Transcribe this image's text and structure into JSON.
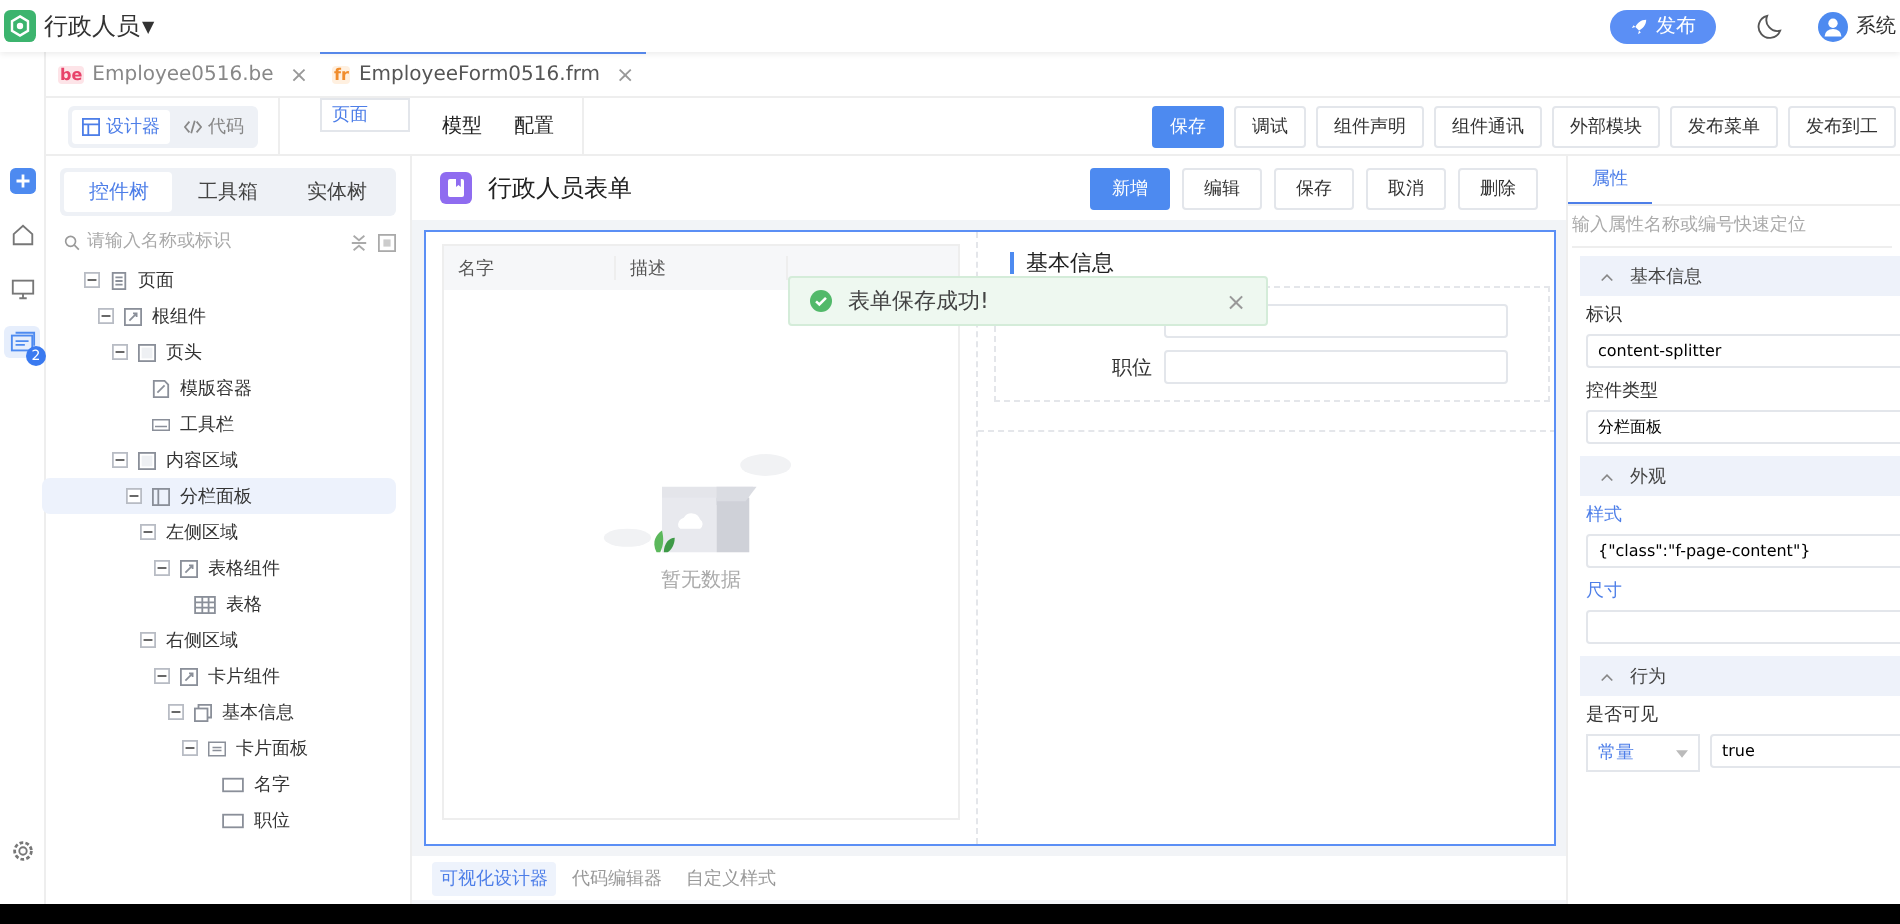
{
  "header": {
    "title": "行政人员",
    "caret": "▼",
    "publish": "发布",
    "user": "系统"
  },
  "file_tabs": [
    {
      "badge": "be",
      "kind": "be",
      "label": "Employee0516.be",
      "close": "×",
      "selected": false
    },
    {
      "badge": "fr",
      "kind": "fr",
      "label": "EmployeeForm0516.frm",
      "close": "×",
      "selected": true
    }
  ],
  "mode_switch": [
    {
      "label": "设计器",
      "kind": "designer",
      "selected": true
    },
    {
      "label": "代码",
      "kind": "code",
      "selected": false
    }
  ],
  "page_tabs": [
    {
      "label": "页面",
      "selected": true
    },
    {
      "label": "模型",
      "selected": false
    },
    {
      "label": "配置",
      "selected": false
    }
  ],
  "toolbar": [
    {
      "label": "保存",
      "primary": true
    },
    {
      "label": "调试",
      "primary": false
    },
    {
      "label": "组件声明",
      "primary": false
    },
    {
      "label": "组件通讯",
      "primary": false
    },
    {
      "label": "外部模块",
      "primary": false
    },
    {
      "label": "发布菜单",
      "primary": false
    },
    {
      "label": "发布到工",
      "primary": false
    }
  ],
  "rail": [
    {
      "kind": "add",
      "selected": false
    },
    {
      "kind": "home",
      "selected": false
    },
    {
      "kind": "monitor",
      "selected": false
    },
    {
      "kind": "cards",
      "selected": true,
      "badge": "2"
    }
  ],
  "left_panel": {
    "tabs": [
      {
        "label": "控件树",
        "selected": true
      },
      {
        "label": "工具箱",
        "selected": false
      },
      {
        "label": "实体树",
        "selected": false
      }
    ],
    "search": {
      "placeholder": "请输入名称或标识"
    },
    "tree": [
      {
        "label": "页面",
        "kind": "page",
        "expanded": true,
        "selected": false,
        "children": [
          {
            "label": "根组件",
            "kind": "component",
            "expanded": true,
            "selected": false,
            "children": [
              {
                "label": "页头",
                "kind": "frame",
                "expanded": true,
                "selected": false,
                "children": [
                  {
                    "label": "模版容器",
                    "kind": "template",
                    "selected": false
                  },
                  {
                    "label": "工具栏",
                    "kind": "toolbar",
                    "selected": false
                  }
                ]
              },
              {
                "label": "内容区域",
                "kind": "frame",
                "expanded": true,
                "selected": false,
                "children": [
                  {
                    "label": "分栏面板",
                    "kind": "splitter",
                    "expanded": true,
                    "selected": true,
                    "children": [
                      {
                        "label": "左侧区域",
                        "expanded": true,
                        "selected": false,
                        "children": [
                          {
                            "label": "表格组件",
                            "kind": "component",
                            "expanded": true,
                            "selected": false,
                            "children": [
                              {
                                "label": "表格",
                                "kind": "table",
                                "selected": false
                              }
                            ]
                          }
                        ]
                      },
                      {
                        "label": "右侧区域",
                        "expanded": true,
                        "selected": false,
                        "children": [
                          {
                            "label": "卡片组件",
                            "kind": "component",
                            "expanded": true,
                            "selected": false,
                            "children": [
                              {
                                "label": "基本信息",
                                "kind": "section",
                                "expanded": true,
                                "selected": false,
                                "children": [
                                  {
                                    "label": "卡片面板",
                                    "kind": "card",
                                    "expanded": true,
                                    "selected": false,
                                    "children": [
                                      {
                                        "label": "名字",
                                        "kind": "field",
                                        "selected": false
                                      },
                                      {
                                        "label": "职位",
                                        "kind": "field",
                                        "selected": false
                                      }
                                    ]
                                  }
                                ]
                              }
                            ]
                          }
                        ]
                      }
                    ]
                  }
                ]
              }
            ]
          }
        ]
      }
    ]
  },
  "form": {
    "title": "行政人员表单",
    "buttons": [
      {
        "label": "新增",
        "primary": true
      },
      {
        "label": "编辑",
        "primary": false
      },
      {
        "label": "保存",
        "primary": false
      },
      {
        "label": "取消",
        "primary": false
      },
      {
        "label": "删除",
        "primary": false
      }
    ],
    "table": {
      "columns": [
        "名字",
        "描述"
      ],
      "empty": "暂无数据"
    },
    "card": {
      "title": "基本信息",
      "fields": [
        {
          "kind": "input"
        },
        {
          "label": "职位",
          "kind": "input"
        }
      ]
    },
    "toast": {
      "message": "表单保存成功!",
      "close": "×"
    }
  },
  "bottom_tabs": [
    {
      "label": "可视化设计器",
      "selected": true
    },
    {
      "label": "代码编辑器",
      "selected": false
    },
    {
      "label": "自定义样式",
      "selected": false
    }
  ],
  "properties": {
    "tabs": [
      {
        "label": "属性",
        "selected": true
      }
    ],
    "search": {
      "placeholder": "输入属性名称或编号快速定位"
    },
    "sections": [
      {
        "title": "基本信息",
        "expanded": true,
        "rows": [
          {
            "label": "标识",
            "linked": false,
            "kind": "text",
            "value": "content-splitter"
          },
          {
            "label": "控件类型",
            "linked": false,
            "kind": "text",
            "value": "分栏面板"
          }
        ]
      },
      {
        "title": "外观",
        "expanded": true,
        "rows": [
          {
            "label": "样式",
            "linked": true,
            "kind": "text",
            "value": "{\"class\":\"f-page-content\"}"
          },
          {
            "label": "尺寸",
            "linked": true,
            "kind": "text"
          }
        ]
      },
      {
        "title": "行为",
        "expanded": true,
        "rows": [
          {
            "label": "是否可见",
            "linked": false,
            "kind": "select",
            "mode": "常量",
            "value": "true"
          }
        ]
      }
    ]
  }
}
